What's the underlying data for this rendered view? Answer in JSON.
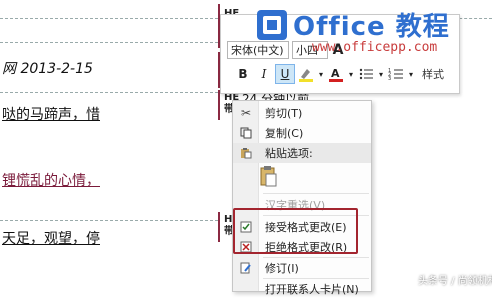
{
  "document": {
    "line1": "网 2013-2-15",
    "line2": "哒的马蹄声，惜",
    "line3": "锂慌乱的心情，",
    "line4": "天足，观望，停"
  },
  "balloons": {
    "label_top": "带格",
    "label_mid": "带格",
    "label_change": "带格",
    "change_text": "24  分钟以前",
    "label_bottom": "带格"
  },
  "mini_toolbar": {
    "font_name": "宋体(中文)",
    "font_size": "小四",
    "style_label": "样式"
  },
  "context_menu": {
    "items": [
      {
        "label": "剪切(T)",
        "icon": "scissors-icon",
        "enabled": true
      },
      {
        "label": "复制(C)",
        "icon": "copy-icon",
        "enabled": true
      },
      {
        "label": "粘贴选项:",
        "icon": "paste-icon",
        "enabled": true
      },
      {
        "label": "汉字重选(V)",
        "icon": "",
        "enabled": false
      },
      {
        "label": "接受格式更改(E)",
        "icon": "accept-icon",
        "enabled": true
      },
      {
        "label": "拒绝格式更改(R)",
        "icon": "reject-icon",
        "enabled": true
      },
      {
        "label": "修订(I)",
        "icon": "track-changes-icon",
        "enabled": true
      },
      {
        "label": "打开联系人卡片(N)",
        "icon": "",
        "enabled": true
      }
    ]
  },
  "watermark": {
    "title": "Office 教程",
    "url": "www.officepp.com",
    "bottom": "头条号 / 尚领机构"
  },
  "colors": {
    "accent_red": "#a3252f",
    "balloon_bar": "#8b2942",
    "watermark_blue": "#2f6fcf"
  }
}
